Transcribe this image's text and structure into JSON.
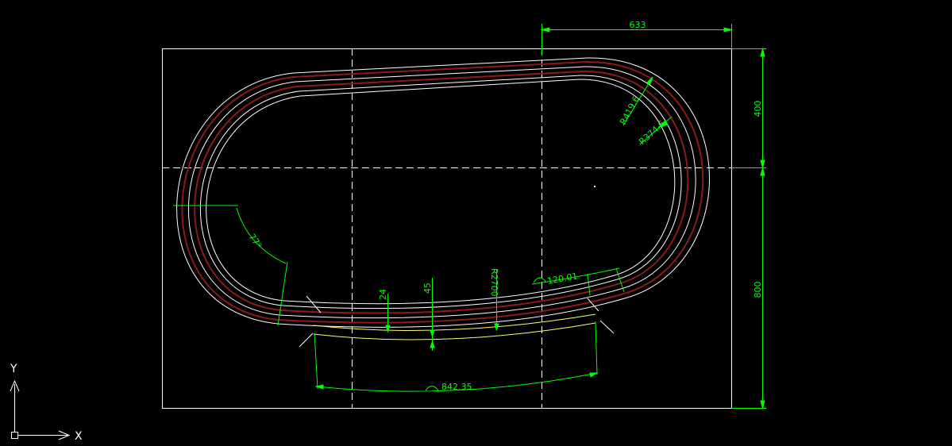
{
  "drawing": {
    "background_color": "#000000",
    "geometry_color": "#ffffff",
    "dimension_color": "#00ff00",
    "track_accent_color": "#8b1a1a",
    "highlight_color": "#ffff66"
  },
  "dimensions": {
    "top_width": "633",
    "upper_height": "400",
    "lower_height": "800",
    "radius_outer": "R419.6",
    "radius_inner": "R374.6",
    "angle": "77°",
    "offset_24": "24",
    "offset_45": "45",
    "radius_large": "R2700",
    "arc_120": "120.01",
    "arc_842": "842.35"
  },
  "ucs": {
    "y_label": "Y",
    "x_label": "X"
  }
}
